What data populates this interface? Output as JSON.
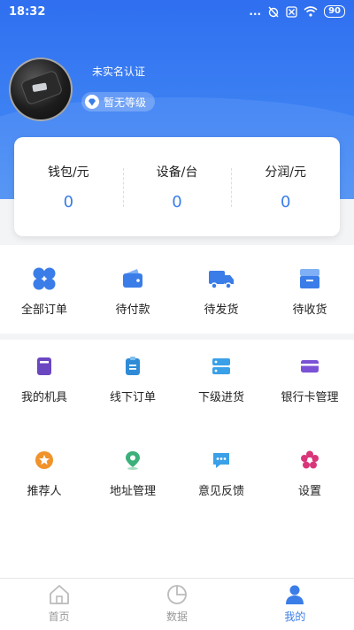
{
  "status_bar": {
    "time": "18:32",
    "dots": "...",
    "battery": "90",
    "icons": [
      "alarm-off-icon",
      "sim-off-icon",
      "wifi-icon",
      "battery-icon"
    ]
  },
  "profile": {
    "auth_status": "未实名认证",
    "level": "暂无等级"
  },
  "stats": [
    {
      "label": "钱包/元",
      "value": "0"
    },
    {
      "label": "设备/台",
      "value": "0"
    },
    {
      "label": "分润/元",
      "value": "0"
    }
  ],
  "orders": [
    {
      "label": "全部订单",
      "icon": "grid-icon"
    },
    {
      "label": "待付款",
      "icon": "wallet-icon"
    },
    {
      "label": "待发货",
      "icon": "truck-icon"
    },
    {
      "label": "待收货",
      "icon": "package-icon"
    }
  ],
  "tools": [
    {
      "label": "我的机具",
      "icon": "device-icon"
    },
    {
      "label": "线下订单",
      "icon": "clipboard-icon"
    },
    {
      "label": "下级进货",
      "icon": "server-icon"
    },
    {
      "label": "银行卡管理",
      "icon": "card-icon"
    },
    {
      "label": "推荐人",
      "icon": "star-icon"
    },
    {
      "label": "地址管理",
      "icon": "location-icon"
    },
    {
      "label": "意见反馈",
      "icon": "chat-icon"
    },
    {
      "label": "设置",
      "icon": "settings-icon"
    }
  ],
  "tabs": [
    {
      "label": "首页",
      "icon": "home-icon"
    },
    {
      "label": "数据",
      "icon": "pie-chart-icon"
    },
    {
      "label": "我的",
      "icon": "user-icon"
    }
  ],
  "colors": {
    "primary": "#3a7de8",
    "header_gradient_top": "#2f6ff0",
    "inactive": "#999999"
  }
}
